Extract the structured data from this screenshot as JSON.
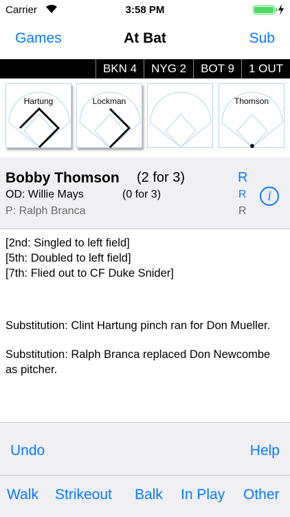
{
  "status_bar": {
    "carrier": "Carrier",
    "time": "3:58 PM"
  },
  "nav": {
    "left": "Games",
    "title": "At Bat",
    "right": "Sub"
  },
  "scoreboard": [
    "BKN 4",
    "NYG 2",
    "BOT 9",
    "1 OUT"
  ],
  "runners": [
    {
      "name": "Hartung",
      "progress": "third"
    },
    {
      "name": "Lockman",
      "progress": "second"
    },
    {
      "name": "",
      "progress": "none"
    },
    {
      "name": "Thomson",
      "progress": "home"
    }
  ],
  "at_bat": {
    "batter_name": "Bobby Thomson",
    "batter_stat": "(2 for 3)",
    "batter_hand": "R",
    "on_deck": "OD: Willie Mays",
    "on_deck_stat": "(0 for 3)",
    "on_deck_hand": "R",
    "pitcher": "P: Ralph Branca",
    "pitcher_hand": "R"
  },
  "log": {
    "lines": [
      "[2nd: Singled to left field]",
      "[5th: Doubled to left field]",
      "[7th: Flied out to CF Duke Snider]"
    ],
    "sub1": "Substitution: Clint Hartung pinch ran for Don Mueller.",
    "sub2": "Substitution: Ralph Branca replaced Don Newcombe as pitcher."
  },
  "toolbar": {
    "undo": "Undo",
    "help": "Help",
    "walk": "Walk",
    "strikeout": "Strikeout",
    "balk": "Balk",
    "in_play": "In Play",
    "other": "Other"
  },
  "colors": {
    "accent": "#0a7aff",
    "battery": "#4cd964",
    "field_line": "#b7d3e8"
  },
  "icons": [
    "wifi-icon",
    "battery-icon",
    "charging-bolt-icon",
    "info-icon"
  ]
}
